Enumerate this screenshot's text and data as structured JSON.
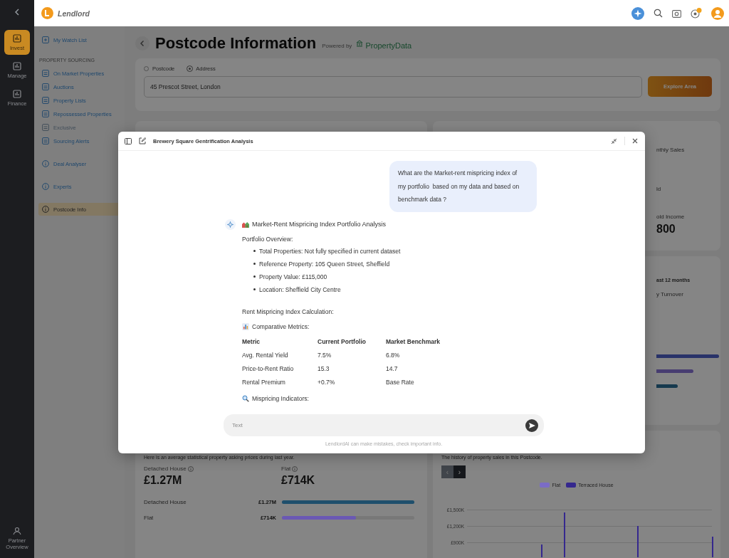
{
  "rail": {
    "items": [
      {
        "label": "Invest",
        "selected": true
      },
      {
        "label": "Manage",
        "selected": false
      },
      {
        "label": "Finance",
        "selected": false
      }
    ],
    "footer_item": {
      "label": "Partner Overview"
    }
  },
  "topbar": {
    "brand": "Lendlord"
  },
  "sidebar": {
    "watch_item": {
      "label": "My Watch List",
      "selected": false,
      "disabled": false
    },
    "section_title": "PROPERTY SOURCING",
    "section_items": [
      {
        "label": "On Market Properties",
        "selected": false,
        "disabled": false
      },
      {
        "label": "Auctions",
        "selected": false,
        "disabled": false
      },
      {
        "label": "Property Lists",
        "selected": false,
        "disabled": false
      },
      {
        "label": "Repossessed Properties",
        "selected": false,
        "disabled": false
      },
      {
        "label": "Exclusive",
        "selected": false,
        "disabled": true
      },
      {
        "label": "Sourcing Alerts",
        "selected": false,
        "disabled": false
      }
    ],
    "tool_items": [
      {
        "label": "Deal Analyser",
        "selected": false,
        "disabled": false
      },
      {
        "label": "Experts",
        "selected": false,
        "disabled": false
      },
      {
        "label": "Postcode Info",
        "selected": true,
        "disabled": false
      }
    ]
  },
  "page": {
    "title": "Postcode Information",
    "powered_by": "Powered by",
    "provider": "PropertyData"
  },
  "search": {
    "modes": [
      {
        "label": "Postcode",
        "selected": false
      },
      {
        "label": "Address",
        "selected": true
      }
    ],
    "value": "45 Prescot Street, London",
    "button": "Explore Area"
  },
  "stats_card": {
    "label_1": "nthly Sales",
    "label_2": "ld",
    "label_3": "old Income",
    "value_3": "800"
  },
  "turnover_card": {
    "heading": "ast 12 months",
    "label": "y Turnover"
  },
  "asking_prices": {
    "intro": "Here is an average statistical property asking prices during last year.",
    "stats": [
      {
        "label": "Detached House",
        "value": "£1.27M"
      },
      {
        "label": "Flat",
        "value": "£714K"
      }
    ],
    "bars": [
      {
        "label": "Detached House",
        "value": "£1.27M",
        "level": 1.0,
        "color": "#1f4f6c"
      },
      {
        "label": "Flat",
        "value": "£714K",
        "level": 0.56,
        "color": "#6a58b4"
      }
    ]
  },
  "sales_history": {
    "intro": "The history of property sales in this Postcode.",
    "nav": [
      {
        "symbol": "‹",
        "disabled": true
      },
      {
        "symbol": "›",
        "disabled": false
      }
    ],
    "legend": [
      {
        "label": "Flat",
        "color": "#7b6cc6"
      },
      {
        "label": "Terraced House",
        "color": "#35288e"
      }
    ],
    "y_labels": [
      "£1,500K",
      "£1,200K",
      "£900K"
    ]
  },
  "chat": {
    "title": "Brewery Square Gentrification Analysis",
    "question": "What are the Market-rent mispricing index of my portfolio  based on my data and based on benchmark data ?",
    "answer_heading": "Market-Rent Mispricing Index Portfolio Analysis",
    "overview_title": "Portfolio Overview:",
    "overview_items": [
      "Total Properties: Not fully specified in current dataset",
      "Reference Property: 105 Queen Street, Sheffield",
      "Property Value: £115,000",
      "Location: Sheffield City Centre"
    ],
    "calc_title": "Rent Mispricing Index Calculation:",
    "metrics_title": "Comparative Metrics:",
    "table": {
      "columns": [
        "Metric",
        "Current Portfolio",
        "Market Benchmark"
      ],
      "rows": [
        [
          "Avg. Rental Yield",
          "7.5%",
          "6.8%"
        ],
        [
          "Price-to-Rent Ratio",
          "15.3",
          "14.7"
        ],
        [
          "Rental Premium",
          "+0.7%",
          "Base Rate"
        ]
      ]
    },
    "indicators_title": "Mispricing Indicators:",
    "input": {
      "placeholder": "Text"
    },
    "disclaimer": "LendlordAI can make mistakes, check important info."
  }
}
